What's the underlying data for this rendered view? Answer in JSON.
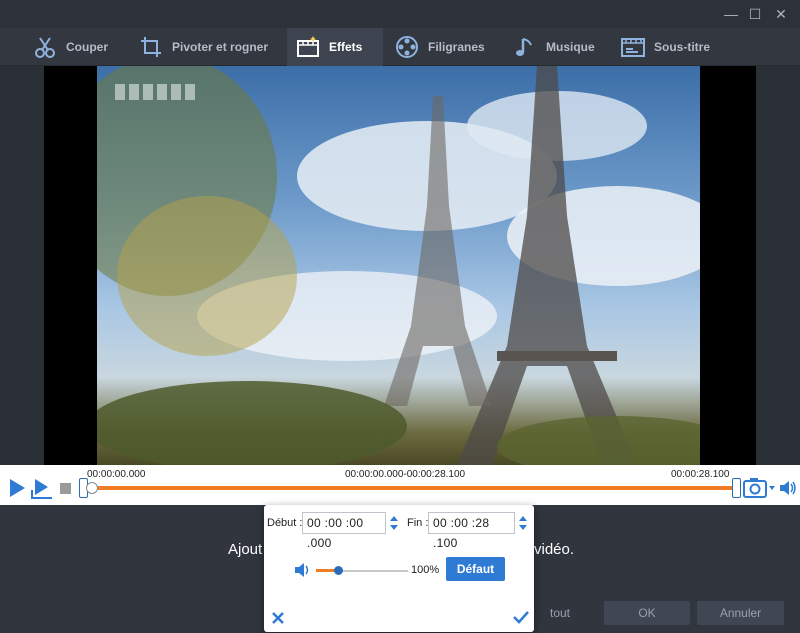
{
  "window": {
    "minimize": "—",
    "maximize": "☐",
    "close": "✕"
  },
  "tabs": [
    {
      "label": "Couper",
      "icon": "scissors-icon"
    },
    {
      "label": "Pivoter et rogner",
      "icon": "crop-rotate-icon"
    },
    {
      "label": "Effets",
      "icon": "effects-film-icon",
      "active": true
    },
    {
      "label": "Filigranes",
      "icon": "watermark-reel-icon"
    },
    {
      "label": "Musique",
      "icon": "music-note-icon"
    },
    {
      "label": "Sous-titre",
      "icon": "subtitle-icon"
    }
  ],
  "timeline": {
    "start": "00:00:00.000",
    "range": "00:00:00.000-00:00:28.100",
    "end": "00:00:28.100"
  },
  "popup": {
    "start_label": "Début :",
    "start_value": "00 :00 :00 .000",
    "end_label": "Fin :",
    "end_value": "00 :00 :28 .100",
    "volume_percent": "100%",
    "volume_level": 0.2,
    "default_button": "Défaut"
  },
  "background": {
    "text_left": "Ajout",
    "text_right": "vidéo.",
    "apply_all": "tout",
    "ok": "OK",
    "cancel": "Annuler"
  },
  "colors": {
    "accent_blue": "#2f7ad3",
    "progress_orange": "#f07c23"
  }
}
